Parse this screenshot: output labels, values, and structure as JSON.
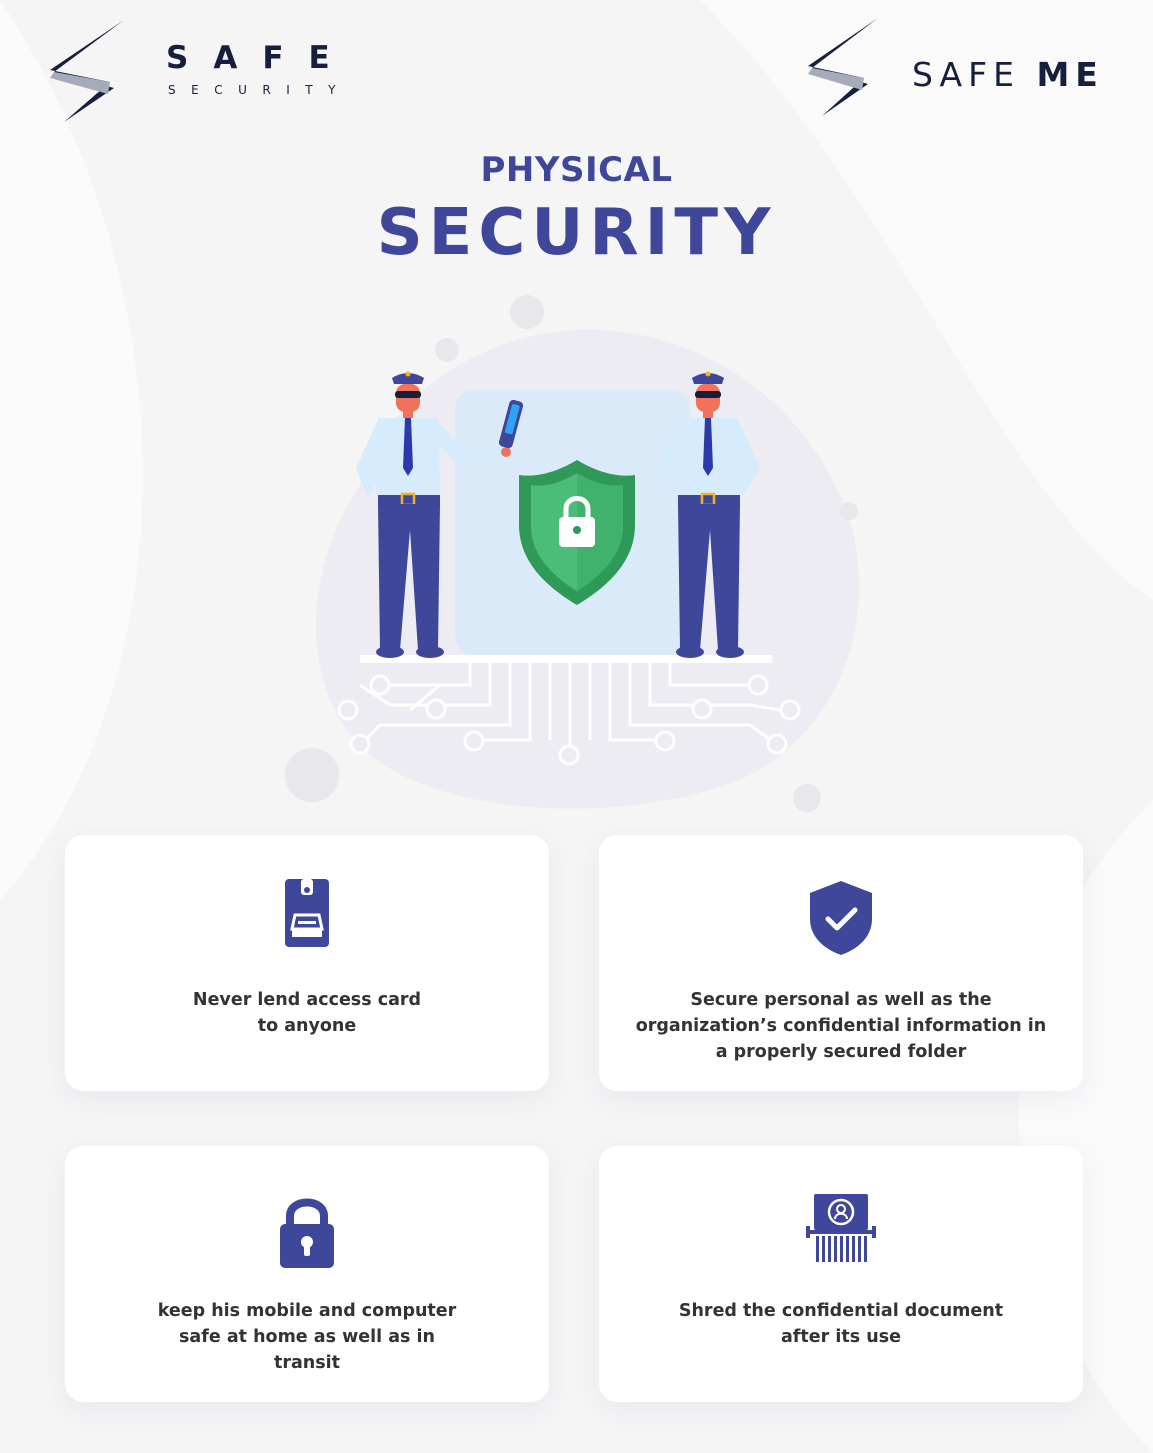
{
  "logos": {
    "left": {
      "name": "SAFE",
      "tagline": "SECURITY"
    },
    "right": {
      "name_part1": "SAFE",
      "name_part2": "ME"
    }
  },
  "title": {
    "line1": "PHYSICAL",
    "line2": "SECURITY"
  },
  "colors": {
    "primary": "#3f479a",
    "navy": "#161f3d",
    "shield_green": "#41b26d",
    "shield_dark_green": "#2f9a58",
    "shirt": "#d6ebfb",
    "card_bg": "#ffffff",
    "text": "#333333"
  },
  "cards": [
    {
      "icon": "access-card-icon",
      "text_line1": "Never lend access card",
      "text_line2": "to anyone"
    },
    {
      "icon": "shield-check-icon",
      "text_line1": "Secure personal as well as the",
      "text_line2": "organization’s confidential information in",
      "text_line3": "a properly secured folder"
    },
    {
      "icon": "padlock-icon",
      "text_line1": "keep his mobile and computer",
      "text_line2": "safe at home as well as in",
      "text_line3": "transit"
    },
    {
      "icon": "document-shredder-icon",
      "text_line1": "Shred the confidential document",
      "text_line2": "after its use"
    }
  ]
}
